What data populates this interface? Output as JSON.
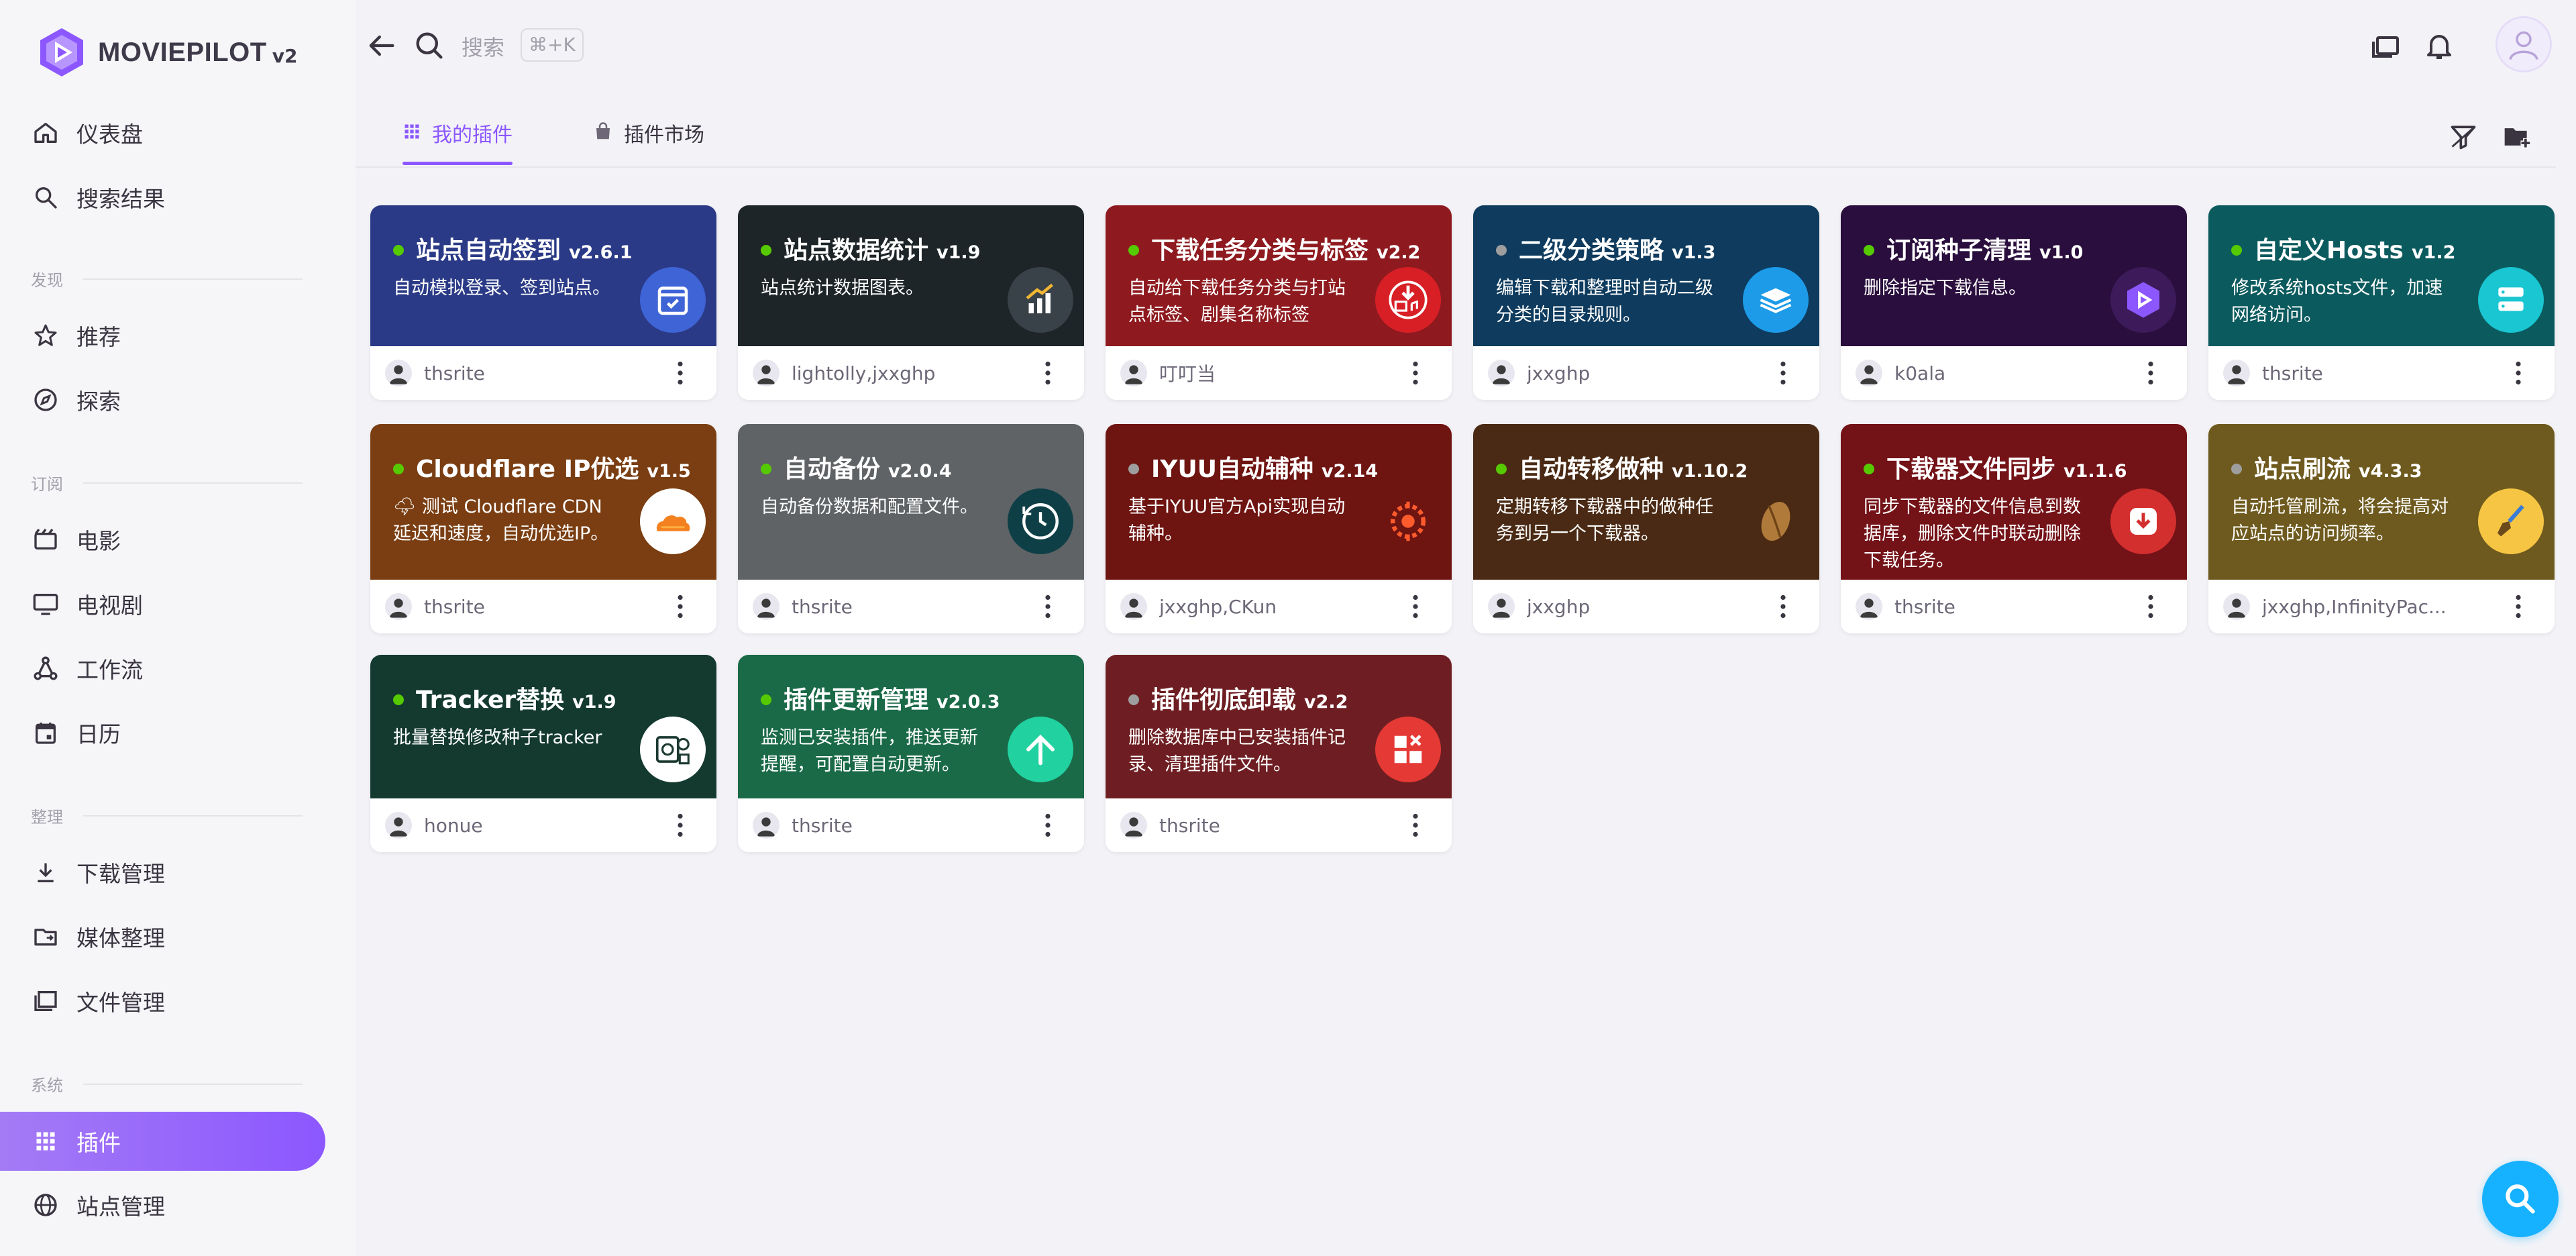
{
  "brand": {
    "name": "MOVIEPILOT",
    "version": "v2",
    "accent": "#8c57ff"
  },
  "sidebar": {
    "items": [
      {
        "label": "仪表盘",
        "icon": "home-icon"
      },
      {
        "label": "搜索结果",
        "icon": "search-icon"
      },
      {
        "label": "推荐",
        "icon": "star-icon"
      },
      {
        "label": "探索",
        "icon": "compass-icon"
      },
      {
        "label": "电影",
        "icon": "movie-icon"
      },
      {
        "label": "电视剧",
        "icon": "tv-icon"
      },
      {
        "label": "工作流",
        "icon": "workflow-icon"
      },
      {
        "label": "日历",
        "icon": "calendar-icon"
      },
      {
        "label": "下载管理",
        "icon": "download-icon"
      },
      {
        "label": "媒体整理",
        "icon": "folder-move-icon"
      },
      {
        "label": "文件管理",
        "icon": "file-manager-icon"
      },
      {
        "label": "插件",
        "icon": "grid-icon",
        "active": true
      },
      {
        "label": "站点管理",
        "icon": "globe-icon"
      }
    ],
    "sections": [
      "发现",
      "订阅",
      "整理",
      "系统"
    ]
  },
  "topbar": {
    "search_placeholder": "搜索",
    "shortcut": "⌘+K"
  },
  "tabs": [
    {
      "label": "我的插件",
      "icon": "grid-icon",
      "active": true
    },
    {
      "label": "插件市场",
      "icon": "store-icon",
      "active": false
    }
  ],
  "plugins": [
    {
      "title": "站点自动签到",
      "version": "v2.6.1",
      "desc": "自动模拟登录、签到站点。",
      "author": "thsrite",
      "enabled": true,
      "bg": "#2a3a86",
      "icon": "calendar-check-icon"
    },
    {
      "title": "站点数据统计",
      "version": "v1.9",
      "desc": "站点统计数据图表。",
      "author": "lightolly,jxxghp",
      "enabled": true,
      "bg": "#1e2528",
      "icon": "bar-chart-icon"
    },
    {
      "title": "下载任务分类与标签",
      "version": "v2.2",
      "desc": "自动给下载任务分类与打站点标签、剧集名称标签",
      "author": "叮叮当",
      "enabled": true,
      "bg": "#8e1a1f",
      "icon": "download-tag-icon"
    },
    {
      "title": "二级分类策略",
      "version": "v1.3",
      "desc": "编辑下载和整理时自动二级分类的目录规则。",
      "author": "jxxghp",
      "enabled": false,
      "bg": "#0e3b5e",
      "icon": "stack-icon"
    },
    {
      "title": "订阅种子清理",
      "version": "v1.0",
      "desc": "删除指定下载信息。",
      "author": "k0ala",
      "enabled": true,
      "bg": "#2a0e3d",
      "icon": "moviepilot-logo-icon"
    },
    {
      "title": "自定义Hosts",
      "version": "v1.2",
      "desc": "修改系统hosts文件，加速网络访问。",
      "author": "thsrite",
      "enabled": true,
      "bg": "#0b5a5e",
      "icon": "server-icon"
    },
    {
      "title": "Cloudflare IP优选",
      "version": "v1.5",
      "desc": "🌩 测试 Cloudflare CDN 延迟和速度，自动优选IP。",
      "author": "thsrite",
      "enabled": true,
      "bg": "#7a3e12",
      "icon": "cloudflare-icon"
    },
    {
      "title": "自动备份",
      "version": "v2.0.4",
      "desc": "自动备份数据和配置文件。",
      "author": "thsrite",
      "enabled": true,
      "bg": "#5f6366",
      "icon": "backup-clock-icon"
    },
    {
      "title": "IYUU自动辅种",
      "version": "v2.14",
      "desc": "基于IYUU官方Api实现自动辅种。",
      "author": "jxxghp,CKun",
      "enabled": false,
      "bg": "#6e1411",
      "icon": "iyuu-icon"
    },
    {
      "title": "自动转移做种",
      "version": "v1.10.2",
      "desc": "定期转移下载器中的做种任务到另一个下载器。",
      "author": "jxxghp",
      "enabled": true,
      "bg": "#4a2a14",
      "icon": "seed-icon"
    },
    {
      "title": "下载器文件同步",
      "version": "v1.1.6",
      "desc": "同步下载器的文件信息到数据库，删除文件时联动删除下载任务。",
      "author": "thsrite",
      "enabled": true,
      "bg": "#731217",
      "icon": "download-sync-icon"
    },
    {
      "title": "站点刷流",
      "version": "v4.3.3",
      "desc": "自动托管刷流，将会提高对应站点的访问频率。",
      "author": "jxxghp,InfinityPac...",
      "enabled": false,
      "bg": "#6e5a1e",
      "icon": "brush-icon"
    },
    {
      "title": "Tracker替换",
      "version": "v1.9",
      "desc": "批量替换修改种子tracker",
      "author": "honue",
      "enabled": true,
      "bg": "#143a30",
      "icon": "tracker-icon"
    },
    {
      "title": "插件更新管理",
      "version": "v2.0.3",
      "desc": "监测已安装插件，推送更新提醒，可配置自动更新。",
      "author": "thsrite",
      "enabled": true,
      "bg": "#1a6a48",
      "icon": "arrow-up-icon"
    },
    {
      "title": "插件彻底卸载",
      "version": "v2.2",
      "desc": "删除数据库中已安装插件记录、清理插件文件。",
      "author": "thsrite",
      "enabled": false,
      "bg": "#6e1e22",
      "icon": "uninstall-icon"
    }
  ],
  "colors": {
    "enabled_dot": "#56ca00",
    "disabled_dot": "#9e9e9e",
    "fab": "#16b1ff"
  }
}
